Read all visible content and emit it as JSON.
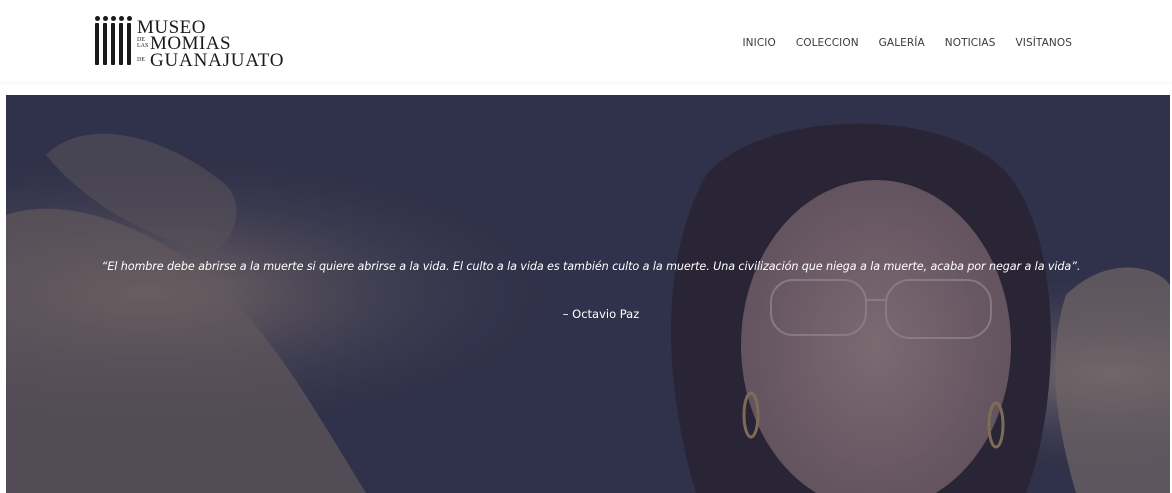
{
  "logo": {
    "line1": "MUSEO",
    "small1": [
      "DE",
      "LAS"
    ],
    "line2": "MOMIAS",
    "small2": "DE",
    "line3": "GUANAJUATO",
    "icon": "mummy-bars-logo"
  },
  "nav": {
    "items": [
      {
        "label": "INICIO"
      },
      {
        "label": "COLECCION"
      },
      {
        "label": "GALERÍA"
      },
      {
        "label": "NOTICIAS"
      },
      {
        "label": "VISÍTANOS"
      }
    ]
  },
  "hero": {
    "quote": "“El hombre debe abrirse a la muerte si quiere abrirse a la vida. El culto a la vida es también culto a la muerte. Una civilización que niega a la muerte, acaba por negar a la vida”.",
    "author": "– Octavio Paz",
    "overlay_color": "#282e4e"
  }
}
